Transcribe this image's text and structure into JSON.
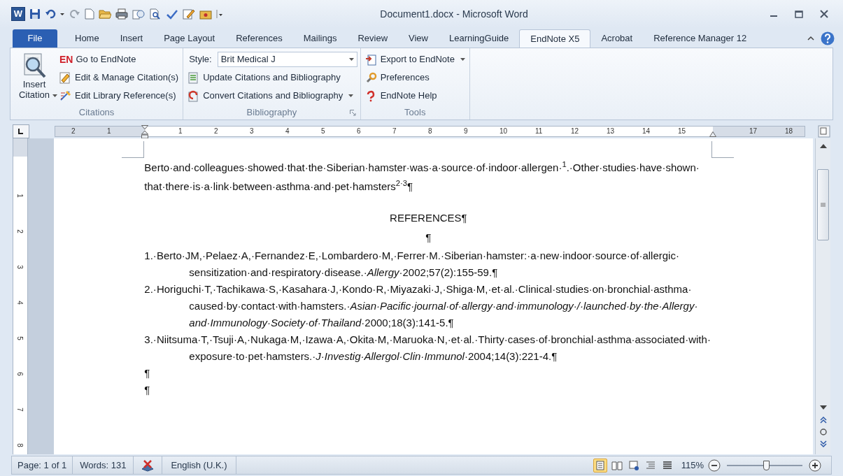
{
  "window": {
    "logo": "W",
    "title": "Document1.docx - Microsoft Word"
  },
  "tabs": [
    {
      "label": "File",
      "kind": "file",
      "selected": false
    },
    {
      "label": "Home",
      "kind": "tab",
      "selected": false
    },
    {
      "label": "Insert",
      "kind": "tab",
      "selected": false
    },
    {
      "label": "Page Layout",
      "kind": "tab",
      "selected": false
    },
    {
      "label": "References",
      "kind": "tab",
      "selected": false
    },
    {
      "label": "Mailings",
      "kind": "tab",
      "selected": false
    },
    {
      "label": "Review",
      "kind": "tab",
      "selected": false
    },
    {
      "label": "View",
      "kind": "tab",
      "selected": false
    },
    {
      "label": "LearningGuide",
      "kind": "tab",
      "selected": false
    },
    {
      "label": "EndNote X5",
      "kind": "tab",
      "selected": true
    },
    {
      "label": "Acrobat",
      "kind": "tab",
      "selected": false
    },
    {
      "label": "Reference Manager 12",
      "kind": "tab",
      "selected": false
    }
  ],
  "ribbon": {
    "groups": [
      {
        "label": "Citations",
        "large_button": {
          "label": "Insert Citation",
          "dropdown": true
        },
        "buttons": [
          {
            "label": "Go to EndNote",
            "badge": "EN",
            "dropdown": false
          },
          {
            "label": "Edit & Manage Citation(s)",
            "dropdown": false
          },
          {
            "label": "Edit Library Reference(s)",
            "dropdown": false
          }
        ]
      },
      {
        "label": "Bibliography",
        "launcher": true,
        "style": {
          "label": "Style:",
          "value": "Brit Medical J"
        },
        "buttons": [
          {
            "label": "Update Citations and Bibliography",
            "dropdown": false
          },
          {
            "label": "Convert Citations and Bibliography",
            "dropdown": true
          }
        ]
      },
      {
        "label": "Tools",
        "buttons": [
          {
            "label": "Export to EndNote",
            "dropdown": true
          },
          {
            "label": "Preferences",
            "dropdown": false
          },
          {
            "label": "EndNote Help",
            "dropdown": false
          }
        ]
      }
    ]
  },
  "ruler": {
    "left_labels": [
      "2",
      "1"
    ],
    "right_labels": [
      "1",
      "2",
      "3",
      "4",
      "5",
      "6",
      "7",
      "8",
      "9",
      "10",
      "11",
      "12",
      "13",
      "14",
      "15"
    ],
    "after_indent_labels": [
      "17",
      "18"
    ],
    "vertical_labels": [
      "1",
      "2",
      "3",
      "4",
      "5",
      "6",
      "7",
      "8"
    ]
  },
  "document": {
    "paragraphs": [
      {
        "kind": "body",
        "text": "Berto·and·colleagues·showed·that·the·Siberian·hamster·was·a·source·of·indoor·allergen·$^{1}$.·Other·studies·have·shown·that·there·is·a·link·between·asthma·and·pet·hamsters$^{2·3}$¶"
      },
      {
        "kind": "heading",
        "text": "REFERENCES¶"
      },
      {
        "kind": "heading",
        "text": "¶"
      },
      {
        "kind": "reference",
        "text": "1.·Berto·JM,·Pelaez·A,·Fernandez·E,·Lombardero·M,·Ferrer·M.·Siberian·hamster:·a·new·indoor·source·of·allergic·sensitization·and·respiratory·disease.·*Allergy*·2002;57(2):155-59.¶"
      },
      {
        "kind": "reference",
        "text": "2.·Horiguchi·T,·Tachikawa·S,·Kasahara·J,·Kondo·R,·Miyazaki·J,·Shiga·M,·et·al.·Clinical·studies·on·bronchial·asthma·caused·by·contact·with·hamsters.·*Asian·Pacific·journal·of·allergy·and·immunology·/·launched·by·the·Allergy·and·Immunology·Society·of·Thailand*·2000;18(3):141-5.¶"
      },
      {
        "kind": "reference",
        "text": "3.·Niitsuma·T,·Tsuji·A,·Nukaga·M,·Izawa·A,·Okita·M,·Maruoka·N,·et·al.·Thirty·cases·of·bronchial·asthma·associated·with·exposure·to·pet·hamsters.·*J·Investig·Allergol·Clin·Immunol*·2004;14(3):221-4.¶"
      },
      {
        "kind": "body",
        "text": "¶"
      },
      {
        "kind": "body",
        "text": "¶"
      }
    ]
  },
  "status_bar": {
    "page": "Page: 1 of 1",
    "words": "Words: 131",
    "language": "English (U.K.)",
    "views": [
      {
        "selected": true
      },
      {
        "selected": false
      },
      {
        "selected": false
      },
      {
        "selected": false
      },
      {
        "selected": false
      }
    ],
    "zoom": "115%",
    "zoom_slider": {
      "level": 0.52
    }
  }
}
